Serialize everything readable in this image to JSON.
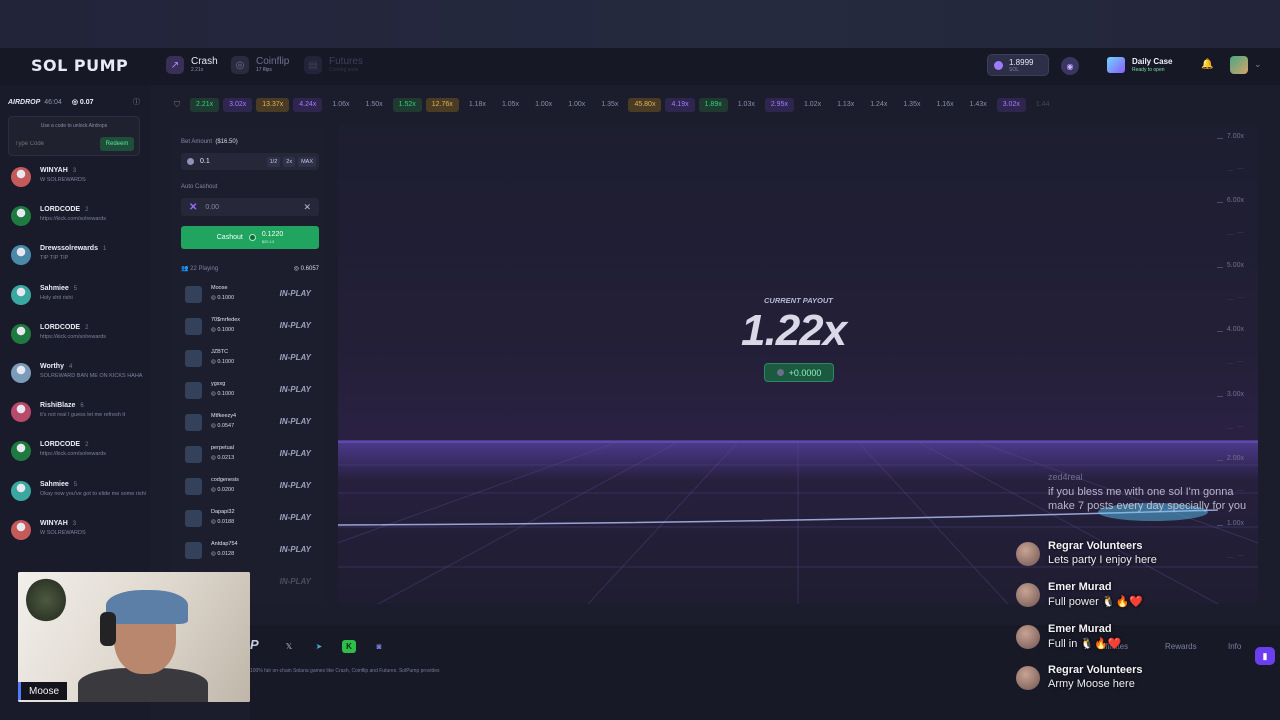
{
  "brand": {
    "logo": "SOL PUMP"
  },
  "nav": {
    "tabs": [
      {
        "label": "Crash",
        "sub": "2.21x",
        "icon": "chart-icon"
      },
      {
        "label": "Coinflip",
        "sub": "17 flips",
        "icon": "coin-icon"
      },
      {
        "label": "Futures",
        "sub": "Coming soon",
        "icon": "futures-icon"
      }
    ],
    "balance": {
      "value": "1.8999",
      "unit": "SOL"
    },
    "daily_case": {
      "title": "Daily Case",
      "sub": "Ready to open"
    }
  },
  "airdrop": {
    "label": "AIRDROP",
    "timer": "46:04",
    "amount": "0.07",
    "hint": "Use a code to unlock Airdrops",
    "code_placeholder": "Type Code",
    "redeem": "Redeem"
  },
  "chat": [
    {
      "name": "WINYAH",
      "level": "3",
      "msg": "W SOLREWARDS",
      "color": "#c45a5a"
    },
    {
      "name": "LORDCODE",
      "level": "2",
      "msg": "https://kick.com/solrewards",
      "color": "#1f7a3f"
    },
    {
      "name": "Drewssolrewards",
      "level": "1",
      "msg": "TIP TIP TIP",
      "color": "#4a8aa8"
    },
    {
      "name": "Sahmiee",
      "level": "5",
      "msg": "Holy shit rishi",
      "color": "#3aa8a0"
    },
    {
      "name": "LORDCODE",
      "level": "2",
      "msg": "https://kick.com/solrewards",
      "color": "#1f7a3f"
    },
    {
      "name": "Worthy",
      "level": "4",
      "msg": "SOLREWARD BAN ME ON KICKS HAHA",
      "color": "#7a9cb8"
    },
    {
      "name": "RishiBlaze",
      "level": "6",
      "msg": "it's not real I guess let me refresh it",
      "color": "#b84a6a"
    },
    {
      "name": "LORDCODE",
      "level": "2",
      "msg": "https://kick.com/solrewards",
      "color": "#1f7a3f"
    },
    {
      "name": "Sahmiee",
      "level": "5",
      "msg": "Okay now you've got to elide me some rishi",
      "color": "#3aa8a0"
    },
    {
      "name": "WINYAH",
      "level": "3",
      "msg": "W SOLREWARDS",
      "color": "#c45a5a"
    }
  ],
  "bet": {
    "amount_label": "Bet Amount",
    "amount_usd": "($16.50)",
    "amount": "0.1",
    "mods": [
      "1/2",
      "2x",
      "MAX"
    ],
    "auto_label": "Auto Cashout",
    "auto_value": "0.00",
    "cashout": {
      "label": "Cashout",
      "value": "0.1220",
      "usd": "$20.13"
    },
    "playing_count": "22 Playing",
    "playing_total": "0.6057",
    "players": [
      {
        "name": "Moose",
        "amount": "0.1000",
        "status": "IN-PLAY"
      },
      {
        "name": "70$mrfedex",
        "amount": "0.1000",
        "status": "IN-PLAY"
      },
      {
        "name": "JZBTC",
        "amount": "0.1000",
        "status": "IN-PLAY"
      },
      {
        "name": "ygsxg",
        "amount": "0.1000",
        "status": "IN-PLAY"
      },
      {
        "name": "Mtfkeezy4",
        "amount": "0.0547",
        "status": "IN-PLAY"
      },
      {
        "name": "perpetual",
        "amount": "0.0213",
        "status": "IN-PLAY"
      },
      {
        "name": "codgenesis",
        "amount": "0.0200",
        "status": "IN-PLAY"
      },
      {
        "name": "Dapapi32",
        "amount": "0.0188",
        "status": "IN-PLAY"
      },
      {
        "name": "Antdap754",
        "amount": "0.0128",
        "status": "IN-PLAY"
      },
      {
        "name": "",
        "amount": "",
        "status": "IN-PLAY"
      }
    ]
  },
  "history": [
    {
      "v": "2.21x",
      "c": "green"
    },
    {
      "v": "3.02x",
      "c": "purple"
    },
    {
      "v": "13.37x",
      "c": "gold"
    },
    {
      "v": "4.24x",
      "c": "purple"
    },
    {
      "v": "1.06x",
      "c": "gray"
    },
    {
      "v": "1.50x",
      "c": "gray"
    },
    {
      "v": "1.52x",
      "c": "green"
    },
    {
      "v": "12.76x",
      "c": "gold"
    },
    {
      "v": "1.18x",
      "c": "gray"
    },
    {
      "v": "1.05x",
      "c": "gray"
    },
    {
      "v": "1.00x",
      "c": "gray"
    },
    {
      "v": "1.00x",
      "c": "gray"
    },
    {
      "v": "1.35x",
      "c": "gray"
    },
    {
      "v": "45.80x",
      "c": "gold"
    },
    {
      "v": "4.19x",
      "c": "purple"
    },
    {
      "v": "1.89x",
      "c": "green"
    },
    {
      "v": "1.03x",
      "c": "gray"
    },
    {
      "v": "2.95x",
      "c": "purple"
    },
    {
      "v": "1.02x",
      "c": "gray"
    },
    {
      "v": "1.13x",
      "c": "gray"
    },
    {
      "v": "1.24x",
      "c": "gray"
    },
    {
      "v": "1.35x",
      "c": "gray"
    },
    {
      "v": "1.16x",
      "c": "gray"
    },
    {
      "v": "1.43x",
      "c": "gray"
    },
    {
      "v": "3.02x",
      "c": "purple"
    },
    {
      "v": "1.44",
      "c": "gray"
    }
  ],
  "game": {
    "payout_label": "CURRENT PAYOUT",
    "payout": "1.22x",
    "profit": "+0.0000",
    "yticks": [
      "7.00x",
      "6.00x",
      "5.00x",
      "4.00x",
      "3.00x",
      "2.00x",
      "1.00x"
    ]
  },
  "footer": {
    "text": "100% fair on-chain Solana games like Crash, Coinflip and Futures. SolPump provides",
    "links": [
      "Affiliates",
      "Rewards",
      "Info"
    ]
  },
  "stream": {
    "name": "Moose"
  },
  "overlay": {
    "faint_name": "zed4real",
    "faint_msg": "if you bless me with one sol I'm gonna make 7 posts every day specially for you",
    "messages": [
      {
        "name": "Regrar Volunteers",
        "msg": "Lets party I enjoy here"
      },
      {
        "name": "Emer Murad",
        "msg": "Full power 🐧🔥❤️"
      },
      {
        "name": "Emer Murad",
        "msg": "Full in 🐧🔥❤️"
      },
      {
        "name": "Regrar Volunteers",
        "msg": "Army Moose here"
      }
    ]
  },
  "colors": {
    "green": "#2fd37a",
    "purple": "#a77bff",
    "gold": "#e0b45a",
    "gray": "#8a8dab"
  }
}
